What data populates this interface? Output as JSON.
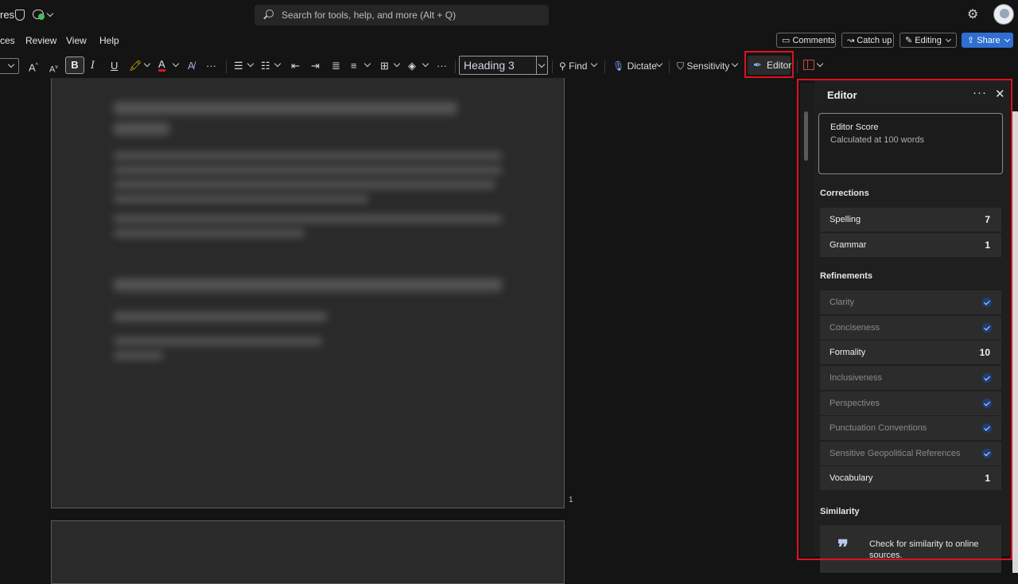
{
  "titlebar": {
    "title_fragment": "res",
    "search_placeholder": "Search for tools, help, and more (Alt + Q)"
  },
  "menu": {
    "items": [
      "ces",
      "Review",
      "View",
      "Help"
    ]
  },
  "actions": {
    "comments": "Comments",
    "catchup": "Catch up",
    "editing": "Editing",
    "share": "Share"
  },
  "ribbon": {
    "font_grow": "A",
    "font_shrink": "A",
    "bold": "B",
    "italic": "I",
    "underline": "U",
    "style_value": "Heading 3",
    "find": "Find",
    "dictate": "Dictate",
    "sensitivity": "Sensitivity",
    "editor": "Editor",
    "more": "···"
  },
  "document": {
    "page_number": "1"
  },
  "editor_panel": {
    "title": "Editor",
    "more": "···",
    "close": "✕",
    "score": {
      "title": "Editor Score",
      "subtitle": "Calculated at 100 words"
    },
    "corrections_heading": "Corrections",
    "corrections": [
      {
        "label": "Spelling",
        "count": "7"
      },
      {
        "label": "Grammar",
        "count": "1"
      }
    ],
    "refinements_heading": "Refinements",
    "refinements": [
      {
        "label": "Clarity",
        "count": "",
        "checked": true
      },
      {
        "label": "Conciseness",
        "count": "",
        "checked": true
      },
      {
        "label": "Formality",
        "count": "10",
        "checked": false
      },
      {
        "label": "Inclusiveness",
        "count": "",
        "checked": true
      },
      {
        "label": "Perspectives",
        "count": "",
        "checked": true
      },
      {
        "label": "Punctuation Conventions",
        "count": "",
        "checked": true
      },
      {
        "label": "Sensitive Geopolitical References",
        "count": "",
        "checked": true
      },
      {
        "label": "Vocabulary",
        "count": "1",
        "checked": false
      }
    ],
    "similarity_heading": "Similarity",
    "similarity_text": "Check for similarity to online sources."
  },
  "colors": {
    "highlight_red": "#e0111b",
    "share_blue": "#2f6fd1",
    "check_blue": "#1f3f7a"
  }
}
